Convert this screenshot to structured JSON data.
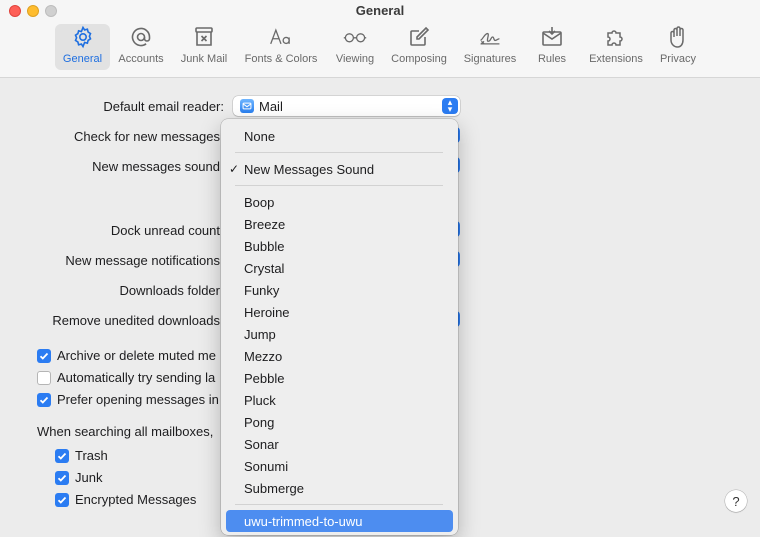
{
  "window": {
    "title": "General"
  },
  "toolbar": [
    {
      "label": "General",
      "icon": "gear-icon",
      "active": true
    },
    {
      "label": "Accounts",
      "icon": "at-icon"
    },
    {
      "label": "Junk Mail",
      "icon": "junk-mail-icon"
    },
    {
      "label": "Fonts & Colors",
      "icon": "fonts-icon"
    },
    {
      "label": "Viewing",
      "icon": "glasses-icon"
    },
    {
      "label": "Composing",
      "icon": "compose-icon"
    },
    {
      "label": "Signatures",
      "icon": "signature-icon"
    },
    {
      "label": "Rules",
      "icon": "rules-icon"
    },
    {
      "label": "Extensions",
      "icon": "puzzle-icon"
    },
    {
      "label": "Privacy",
      "icon": "hand-icon"
    }
  ],
  "settings": {
    "default_reader_label": "Default email reader:",
    "default_reader_value": "Mail",
    "check_messages_label": "Check for new messages",
    "new_sound_label": "New messages sound",
    "dock_unread_label": "Dock unread count",
    "notifications_label": "New message notifications",
    "downloads_folder_label": "Downloads folder",
    "remove_downloads_label": "Remove unedited downloads",
    "archive_muted_label": "Archive or delete muted me",
    "auto_send_label": "Automatically try sending la",
    "prefer_opening_label": "Prefer opening messages in",
    "searching_label": "When searching all mailboxes,",
    "trash_label": "Trash",
    "junk_label": "Junk",
    "encrypted_label": "Encrypted Messages"
  },
  "menu": {
    "none": "None",
    "current": "New Messages Sound",
    "sounds": [
      "Boop",
      "Breeze",
      "Bubble",
      "Crystal",
      "Funky",
      "Heroine",
      "Jump",
      "Mezzo",
      "Pebble",
      "Pluck",
      "Pong",
      "Sonar",
      "Sonumi",
      "Submerge"
    ],
    "custom": "uwu-trimmed-to-uwu"
  },
  "help": "?",
  "colors": {
    "accent": "#2b7cf2",
    "selection": "#4d8df0"
  }
}
